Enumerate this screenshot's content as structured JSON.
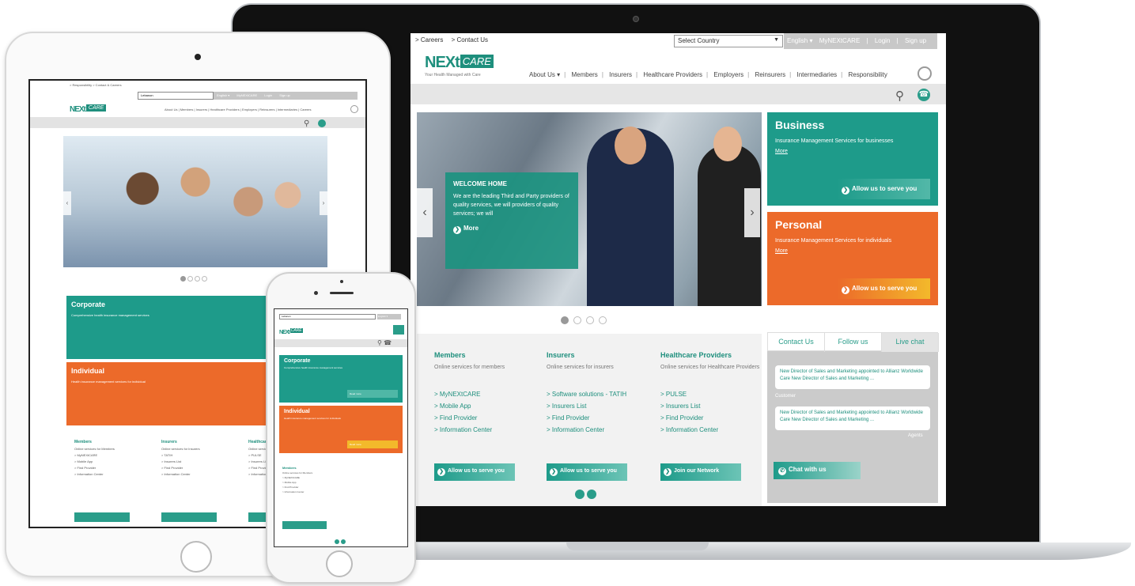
{
  "laptop": {
    "top_links": [
      "> Careers",
      "> Contact Us"
    ],
    "country_placeholder": "Select Country",
    "top_bar": [
      "English ▾",
      "MyNEXtCARE",
      "|",
      "Login",
      "|",
      "Sign up"
    ],
    "logo": {
      "next": "NEXt",
      "care": "CARE",
      "tagline": "Your Health Managed with Care"
    },
    "nav": [
      "About Us ▾",
      "Members",
      "Insurers",
      "Healthcare Providers",
      "Employers",
      "Reinsurers",
      "Intermediaries",
      "Responsibility"
    ],
    "hero": {
      "title": "WELCOME HOME",
      "text": "We are the leading Third and Party providers of quality services, we will providers of quality services; we will",
      "more": "More"
    },
    "business": {
      "title": "Business",
      "desc": "Insurance Management Services for businesses",
      "more": "More",
      "cta": "Allow us to serve you"
    },
    "personal": {
      "title": "Personal",
      "desc": "Insurance Management Services for individuals",
      "more": "More",
      "cta": "Allow us to serve you"
    },
    "columns": [
      {
        "title": "Members",
        "sub": "Online services for members",
        "links": [
          "> MyNEXtCARE",
          "> Mobile App",
          "> Find Provider",
          "> Information Center"
        ],
        "cta": "Allow us to serve you"
      },
      {
        "title": "Insurers",
        "sub": "Online services for insurers",
        "links": [
          "> Software solutions - TATIH",
          "> Insurers List",
          "> Find Provider",
          "> Information Center"
        ],
        "cta": "Allow us to serve you"
      },
      {
        "title": "Healthcare Providers",
        "sub": "Online services for Healthcare Providers",
        "links": [
          "> PULSE",
          "> Insurers List",
          "> Find Provider",
          "> Information Center"
        ],
        "cta": "Join our Network"
      }
    ],
    "side_tabs": [
      "Contact Us",
      "Follow us",
      "Live chat"
    ],
    "news": [
      {
        "text": "New Director of Sales and Marketing appointed to Allianz Worldwide Care New Director of Sales and Marketing ...",
        "author": "Customer"
      },
      {
        "text": "New Director of Sales and Marketing appointed to Allianz Worldwide Care New Director of Sales and Marketing ...",
        "author": "Agents"
      }
    ],
    "chat_cta": "Chat with us"
  },
  "tablet": {
    "top_links": "> Responsibility   > Contact & Careers",
    "select": "Lebanon",
    "top_bar": [
      "English ▾",
      "MyNEXtCARE",
      "Login",
      "Sign up"
    ],
    "nav": "About Us | Members | Insurers | Healthcare Providers | Employers | Reinsurers | Intermediaries | Careers",
    "corporate": {
      "title": "Corporate",
      "desc": "Comprehensive health insurance management services"
    },
    "individual": {
      "title": "Individual",
      "desc": "Health insurance management services for individual"
    },
    "columns": [
      {
        "title": "Members",
        "sub": "Online services for Members",
        "links": [
          "> MyNEXtCARE",
          "> Mobile App",
          "> Find Provider",
          "> Information Center"
        ]
      },
      {
        "title": "Insurers",
        "sub": "Online services for Insurers",
        "links": [
          "> TATIH",
          "> Insurers List",
          "> Find Provider",
          "> Information Center"
        ]
      },
      {
        "title": "Healthcare Providers",
        "sub": "Online services for Providers",
        "links": [
          "> PULSE",
          "> Insurers List",
          "> Find Provider",
          "> Information Center"
        ]
      }
    ]
  },
  "phone": {
    "select": "Lebanon",
    "lang": "English ▾",
    "corporate": {
      "title": "Corporate",
      "desc": "Comprehensive health insurance management services",
      "cta": "Read more"
    },
    "individual": {
      "title": "Individual",
      "desc": "Health insurance management services for individuals",
      "cta": "Read more"
    },
    "members": {
      "title": "Members",
      "sub": "Online services for Members",
      "links": [
        "> MyNEXtCARE",
        "> Mobile App",
        "> Find Provider",
        "> Information Center"
      ]
    }
  },
  "colors": {
    "teal": "#1e9b8a",
    "orange": "#ec6a2a",
    "yellow": "#f3b92b",
    "gray": "#c8c8c8"
  }
}
